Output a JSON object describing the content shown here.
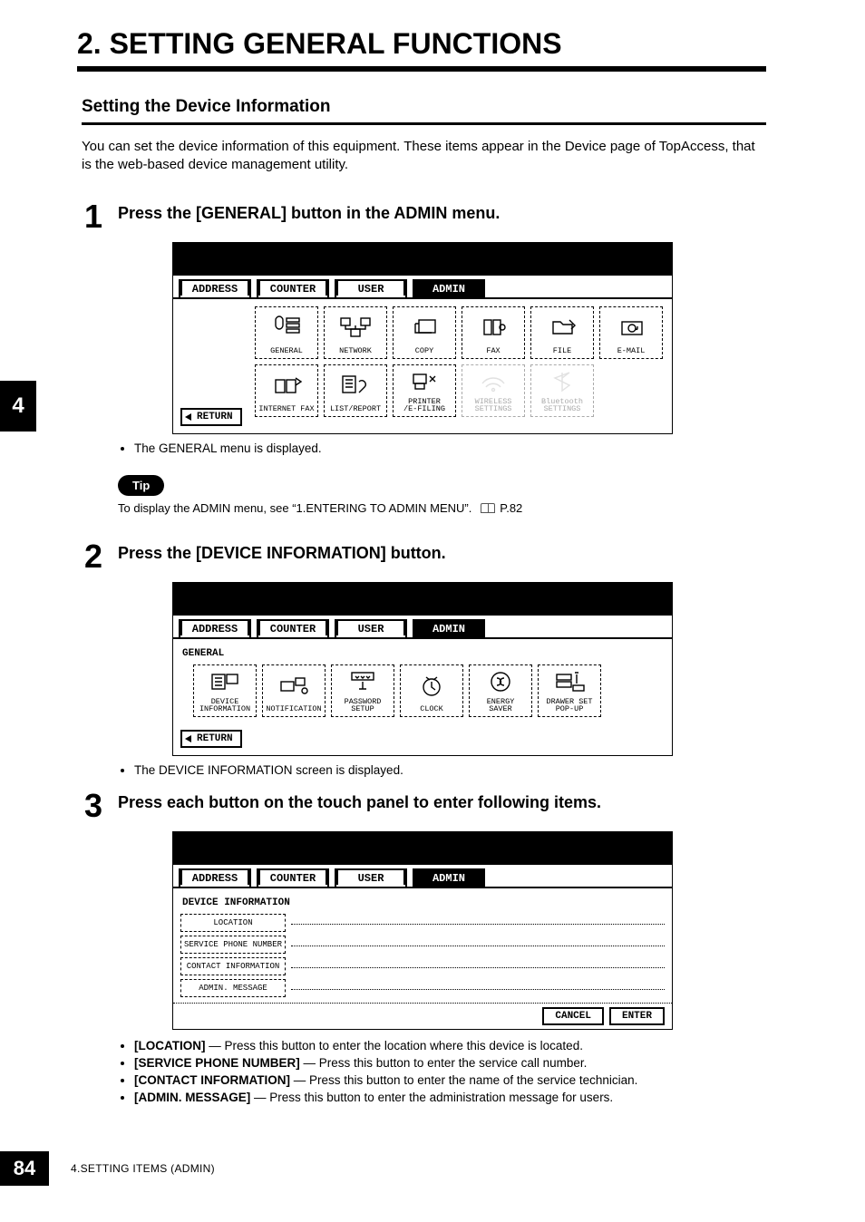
{
  "chapter_title": "2. SETTING GENERAL FUNCTIONS",
  "section_title": "Setting the Device Information",
  "intro": "You can set the device information of this equipment.  These items appear in the Device page of TopAccess, that is the web-based device management utility.",
  "side_tab": "4",
  "page_number": "84",
  "footer": "4.SETTING ITEMS (ADMIN)",
  "tip_label": "Tip",
  "tip_text": "To display the ADMIN menu, see “1.ENTERING TO ADMIN MENU”.",
  "tip_ref": "P.82",
  "tabs": {
    "address": "ADDRESS",
    "counter": "COUNTER",
    "user": "USER",
    "admin": "ADMIN"
  },
  "return_label": "RETURN",
  "steps": {
    "s1": {
      "num": "1",
      "title": "Press the [GENERAL] button in the ADMIN menu.",
      "note": "The GENERAL menu is displayed.",
      "buttons": {
        "general": "GENERAL",
        "network": "NETWORK",
        "copy": "COPY",
        "fax": "FAX",
        "file": "FILE",
        "email": "E-MAIL",
        "ifax": "INTERNET FAX",
        "list": "LIST/REPORT",
        "printer": "PRINTER\n/E-FILING",
        "wireless": "WIRELESS\nSETTINGS",
        "bluetooth": "Bluetooth\nSETTINGS"
      }
    },
    "s2": {
      "num": "2",
      "title": "Press the [DEVICE INFORMATION] button.",
      "note": "The DEVICE INFORMATION screen is displayed.",
      "panel_label": "GENERAL",
      "buttons": {
        "device": "DEVICE\nINFORMATION",
        "notification": "NOTIFICATION",
        "password": "PASSWORD SETUP",
        "clock": "CLOCK",
        "energy": "ENERGY\nSAVER",
        "drawer": "DRAWER SET\nPOP-UP"
      }
    },
    "s3": {
      "num": "3",
      "title": "Press each button on the touch panel to enter following items.",
      "panel_label": "DEVICE INFORMATION",
      "fields": {
        "location": "LOCATION",
        "service": "SERVICE PHONE NUMBER",
        "contact": "CONTACT INFORMATION",
        "admin": "ADMIN. MESSAGE"
      },
      "cancel": "CANCEL",
      "enter": "ENTER",
      "desc": {
        "location_b": "[LOCATION]",
        "location_t": " — Press this button to enter the location where this device is located.",
        "service_b": "[SERVICE PHONE NUMBER]",
        "service_t": " — Press this button to enter the service call number.",
        "contact_b": "[CONTACT INFORMATION]",
        "contact_t": " — Press this button to enter the name of the service technician.",
        "admin_b": "[ADMIN. MESSAGE]",
        "admin_t": " — Press this button to enter the administration message for users."
      }
    }
  }
}
